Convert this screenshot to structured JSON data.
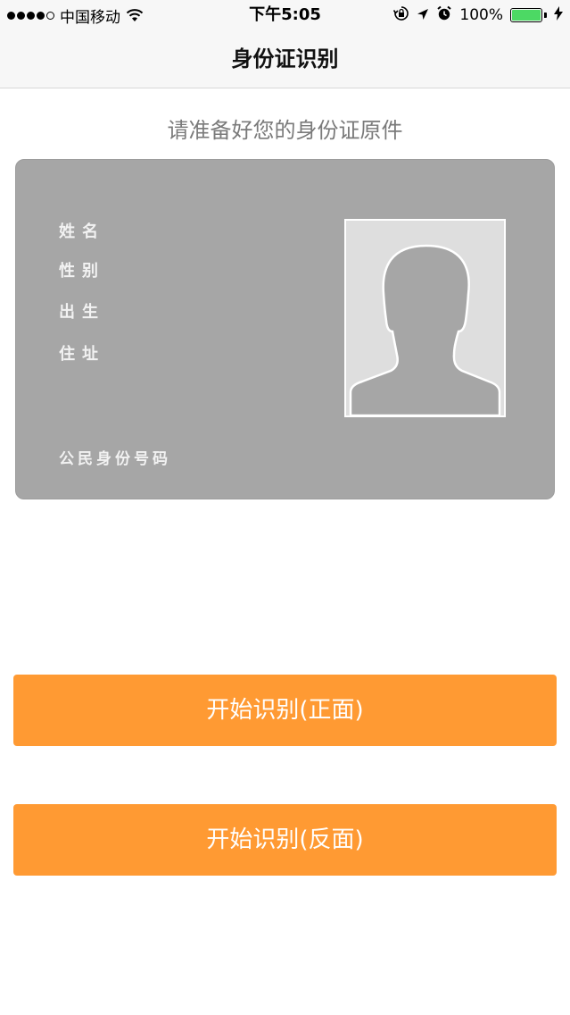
{
  "status_bar": {
    "carrier": "中国移动",
    "time": "下午5:05",
    "battery_percent": "100%",
    "battery_level": 1.0,
    "battery_color": "#4cd964",
    "icons": [
      "signal-dots-icon",
      "wifi-icon",
      "orientation-lock-icon",
      "location-arrow-icon",
      "alarm-clock-icon",
      "charging-bolt-icon"
    ]
  },
  "nav": {
    "title": "身份证识别"
  },
  "prompt": "请准备好您的身份证原件",
  "id_card": {
    "name_label": "姓名",
    "gender_label": "性别",
    "birth_label": "出生",
    "address_label": "住址",
    "id_number_label": "公民身份号码",
    "photo_icon": "person-silhouette-icon"
  },
  "buttons": {
    "scan_front": "开始识别(正面)",
    "scan_back": "开始识别(反面)"
  },
  "colors": {
    "accent": "#ff9a33",
    "card_background": "#a6a6a6",
    "photo_background": "#dedede"
  }
}
